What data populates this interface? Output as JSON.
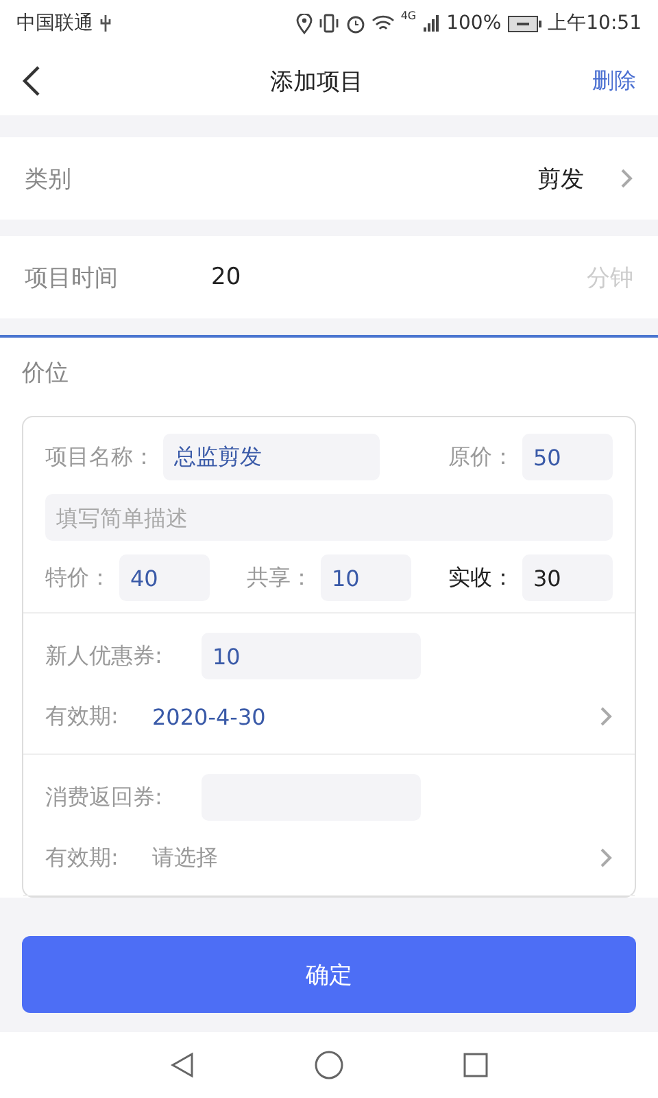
{
  "status_bar": {
    "carrier": "中国联通",
    "network": "4G",
    "battery": "100%",
    "time": "上午10:51"
  },
  "nav": {
    "title": "添加项目",
    "action": "删除"
  },
  "category": {
    "label": "类别",
    "value": "剪发"
  },
  "duration": {
    "label": "项目时间",
    "value": "20",
    "unit": "分钟"
  },
  "pricing": {
    "title": "价位",
    "name": {
      "label": "项目名称：",
      "value": "总监剪发"
    },
    "original": {
      "label": "原价：",
      "value": "50"
    },
    "description": {
      "placeholder": "填写简单描述"
    },
    "prices": [
      {
        "label": "特价：",
        "value": "40",
        "emphasized": false
      },
      {
        "label": "共享：",
        "value": "10",
        "emphasized": false
      },
      {
        "label": "实收：",
        "value": "30",
        "emphasized": true
      }
    ],
    "coupons": [
      {
        "label": "新人优惠券:",
        "amount": "10",
        "expiry_label": "有效期:",
        "expiry": "2020-4-30"
      },
      {
        "label": "消费返回券:",
        "expiry_label": "有效期:",
        "expiry_placeholder": "请选择"
      }
    ]
  },
  "confirm": "确定"
}
